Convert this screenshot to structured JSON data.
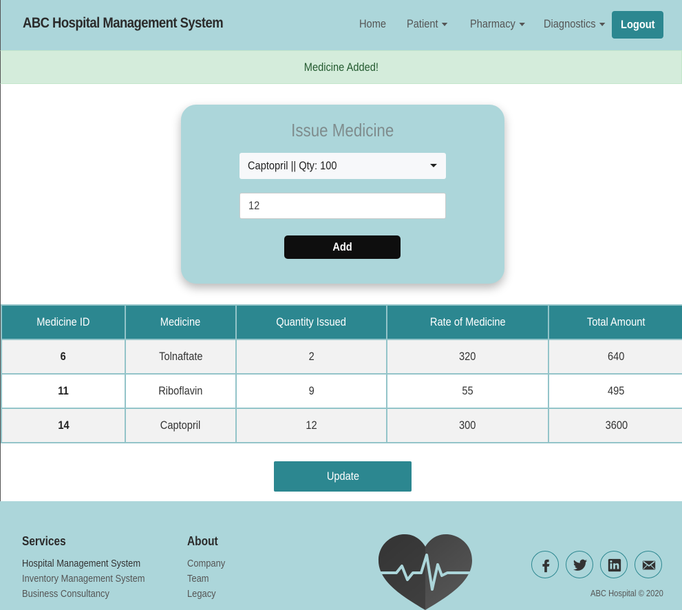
{
  "navbar": {
    "brand": "ABC Hospital Management System",
    "items": [
      {
        "label": "Home",
        "dropdown": false
      },
      {
        "label": "Patient",
        "dropdown": true
      },
      {
        "label": "Pharmacy",
        "dropdown": true
      },
      {
        "label": "Diagnostics",
        "dropdown": true
      }
    ],
    "logout_label": "Logout"
  },
  "alert": {
    "message": "Medicine Added!"
  },
  "issue_form": {
    "title": "Issue Medicine",
    "selected_medicine": "Captopril || Qty: 100",
    "quantity_value": "12",
    "add_label": "Add"
  },
  "table": {
    "headers": [
      "Medicine ID",
      "Medicine",
      "Quantity Issued",
      "Rate of Medicine",
      "Total Amount"
    ],
    "rows": [
      [
        "6",
        "Tolnaftate",
        "2",
        "320",
        "640"
      ],
      [
        "11",
        "Riboflavin",
        "9",
        "55",
        "495"
      ],
      [
        "14",
        "Captopril",
        "12",
        "300",
        "3600"
      ]
    ]
  },
  "update_label": "Update",
  "footer": {
    "services_heading": "Services",
    "services": [
      "Hospital Management System",
      "Inventory Management System",
      "Business Consultancy"
    ],
    "about_heading": "About",
    "about": [
      "Company",
      "Team",
      "Legacy"
    ],
    "social_icons": [
      "facebook-icon",
      "twitter-icon",
      "linkedin-icon",
      "mail-icon"
    ],
    "copyright": "ABC Hospital © 2020"
  },
  "colors": {
    "nav_bg": "#acd6da",
    "accent": "#2c8790",
    "alert_bg": "#d4ecdb",
    "add_button": "#0e0e0e"
  }
}
